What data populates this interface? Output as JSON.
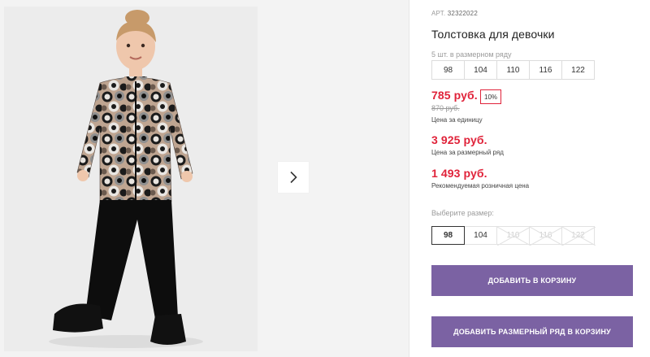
{
  "product": {
    "art_label": "АРТ.",
    "art_number": "32322022",
    "title": "Толстовка для девочки",
    "row_note": "5 шт. в размерном ряду",
    "row_sizes": [
      "98",
      "104",
      "110",
      "116",
      "122"
    ]
  },
  "prices": {
    "current": "785 руб.",
    "discount": "10%",
    "old": "870 руб.",
    "unit_label": "Цена за единицу",
    "row_price": "3 925 руб.",
    "row_label": "Цена за размерный ряд",
    "retail_price": "1 493 руб.",
    "retail_label": "Рекомендуемая розничная цена"
  },
  "size_picker": {
    "label": "Выберите размер:",
    "options": [
      {
        "label": "98",
        "state": "selected"
      },
      {
        "label": "104",
        "state": "available"
      },
      {
        "label": "110",
        "state": "unavailable"
      },
      {
        "label": "116",
        "state": "unavailable"
      },
      {
        "label": "122",
        "state": "unavailable"
      }
    ]
  },
  "actions": {
    "add_to_cart": "ДОБАВИТЬ В КОРЗИНУ",
    "add_row_to_cart": "ДОБАВИТЬ РАЗМЕРНЫЙ РЯД В КОРЗИНУ"
  },
  "gallery": {
    "next_icon": "chevron-right-icon"
  },
  "colors": {
    "accent_button": "#7b62a3",
    "price_red": "#e0233a",
    "muted_text": "#9a9a9a"
  }
}
